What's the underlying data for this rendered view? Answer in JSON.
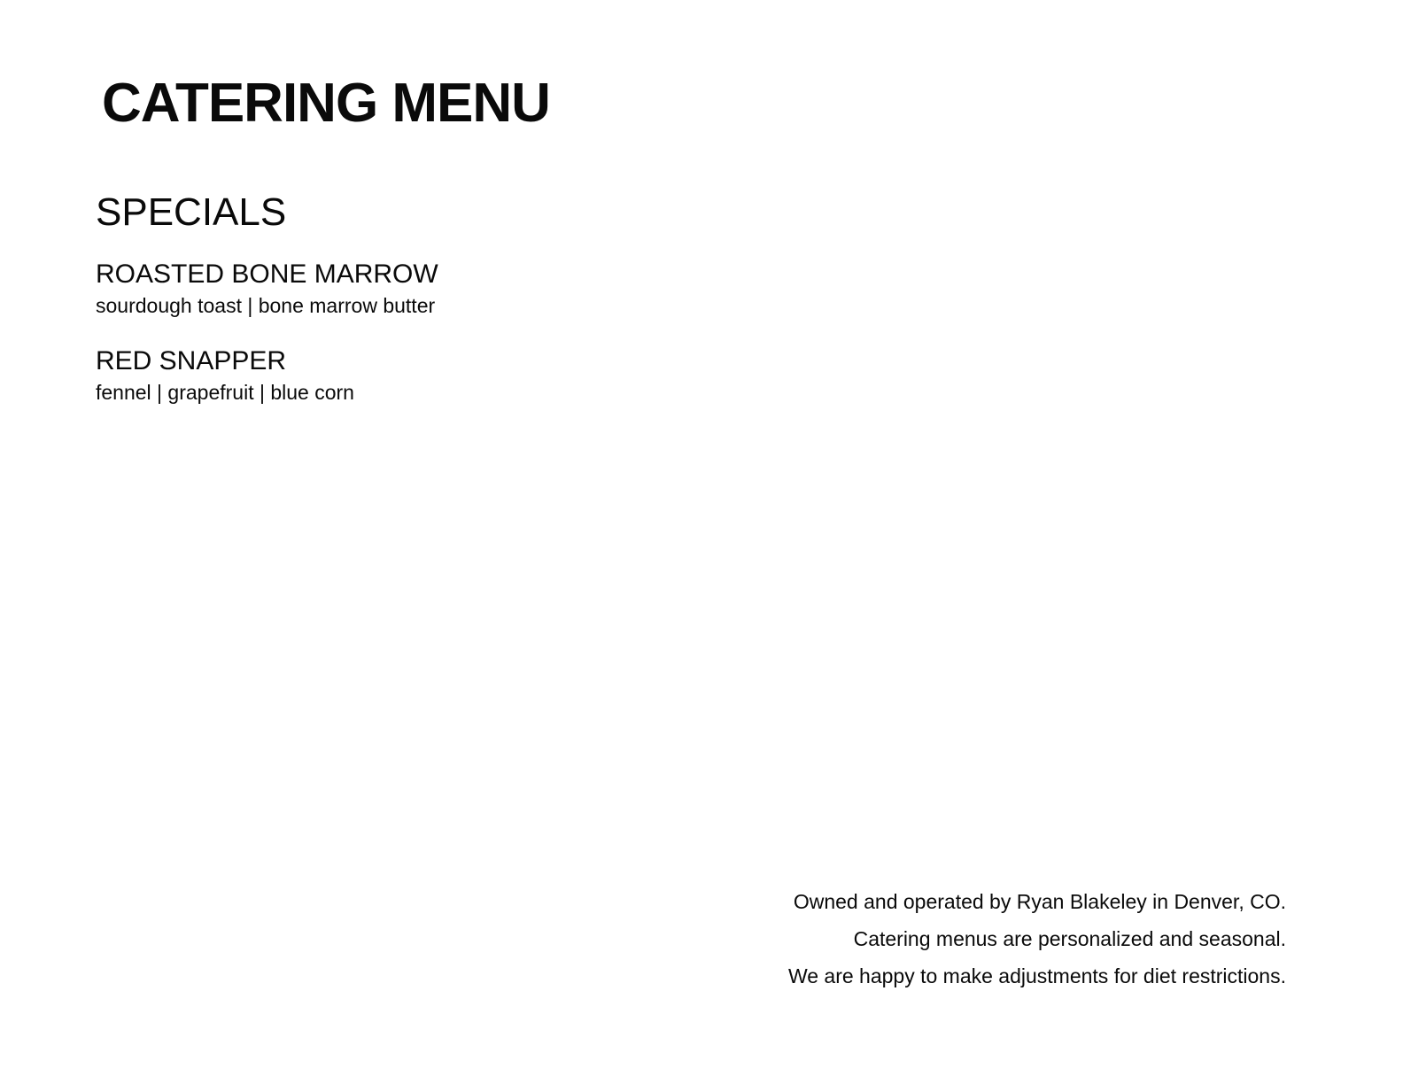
{
  "header": {
    "title": "CATERING MENU"
  },
  "specials": {
    "heading": "SPECIALS",
    "items": [
      {
        "name": "ROASTED BONE MARROW",
        "description": "sourdough toast | bone marrow butter"
      },
      {
        "name": "RED SNAPPER",
        "description": "fennel | grapefruit | blue corn"
      }
    ]
  },
  "footer": {
    "lines": [
      "Owned and operated by Ryan Blakeley in Denver, CO.",
      "Catering menus are personalized and seasonal.",
      "We are happy to make adjustments for diet restrictions."
    ]
  }
}
